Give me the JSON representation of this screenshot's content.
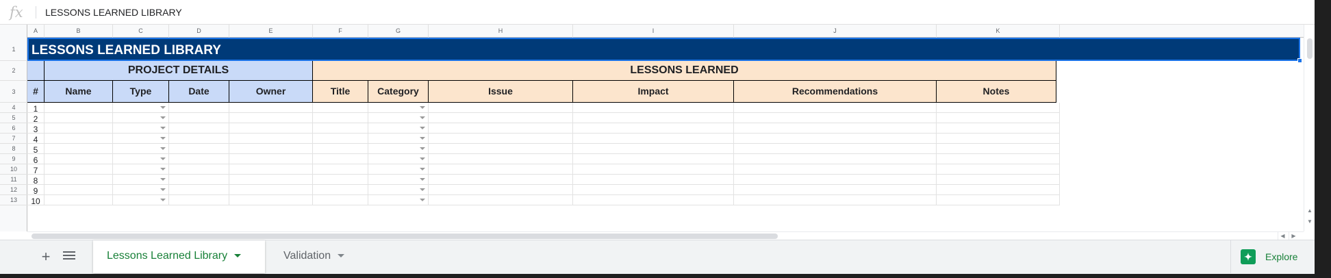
{
  "formula_bar": {
    "fx_label": "fx",
    "value": "LESSONS LEARNED LIBRARY"
  },
  "columns": [
    "A",
    "B",
    "C",
    "D",
    "E",
    "F",
    "G",
    "H",
    "I",
    "J",
    "K"
  ],
  "rows": [
    "1",
    "2",
    "3",
    "4",
    "5",
    "6",
    "7",
    "8",
    "9",
    "10",
    "11",
    "12",
    "13"
  ],
  "sheet": {
    "title": "LESSONS LEARNED LIBRARY",
    "section_project": "PROJECT DETAILS",
    "section_lessons": "LESSONS LEARNED",
    "col_headers": [
      "#",
      "Name",
      "Type",
      "Date",
      "Owner",
      "Title",
      "Category",
      "Issue",
      "Impact",
      "Recommendations",
      "Notes"
    ],
    "row_numbers": [
      "1",
      "2",
      "3",
      "4",
      "5",
      "6",
      "7",
      "8",
      "9",
      "10"
    ],
    "dropdown_columns": [
      "Type",
      "Category"
    ]
  },
  "tabs": [
    {
      "label": "Lessons Learned Library",
      "active": true
    },
    {
      "label": "Validation",
      "active": false
    }
  ],
  "explore": {
    "label": "Explore",
    "icon": "explore-icon"
  },
  "colors": {
    "title_bg": "#003a78",
    "project_section": "#c9daf8",
    "lessons_section": "#fce5cd",
    "active_tab_text": "#188038",
    "selection": "#1a73e8"
  }
}
